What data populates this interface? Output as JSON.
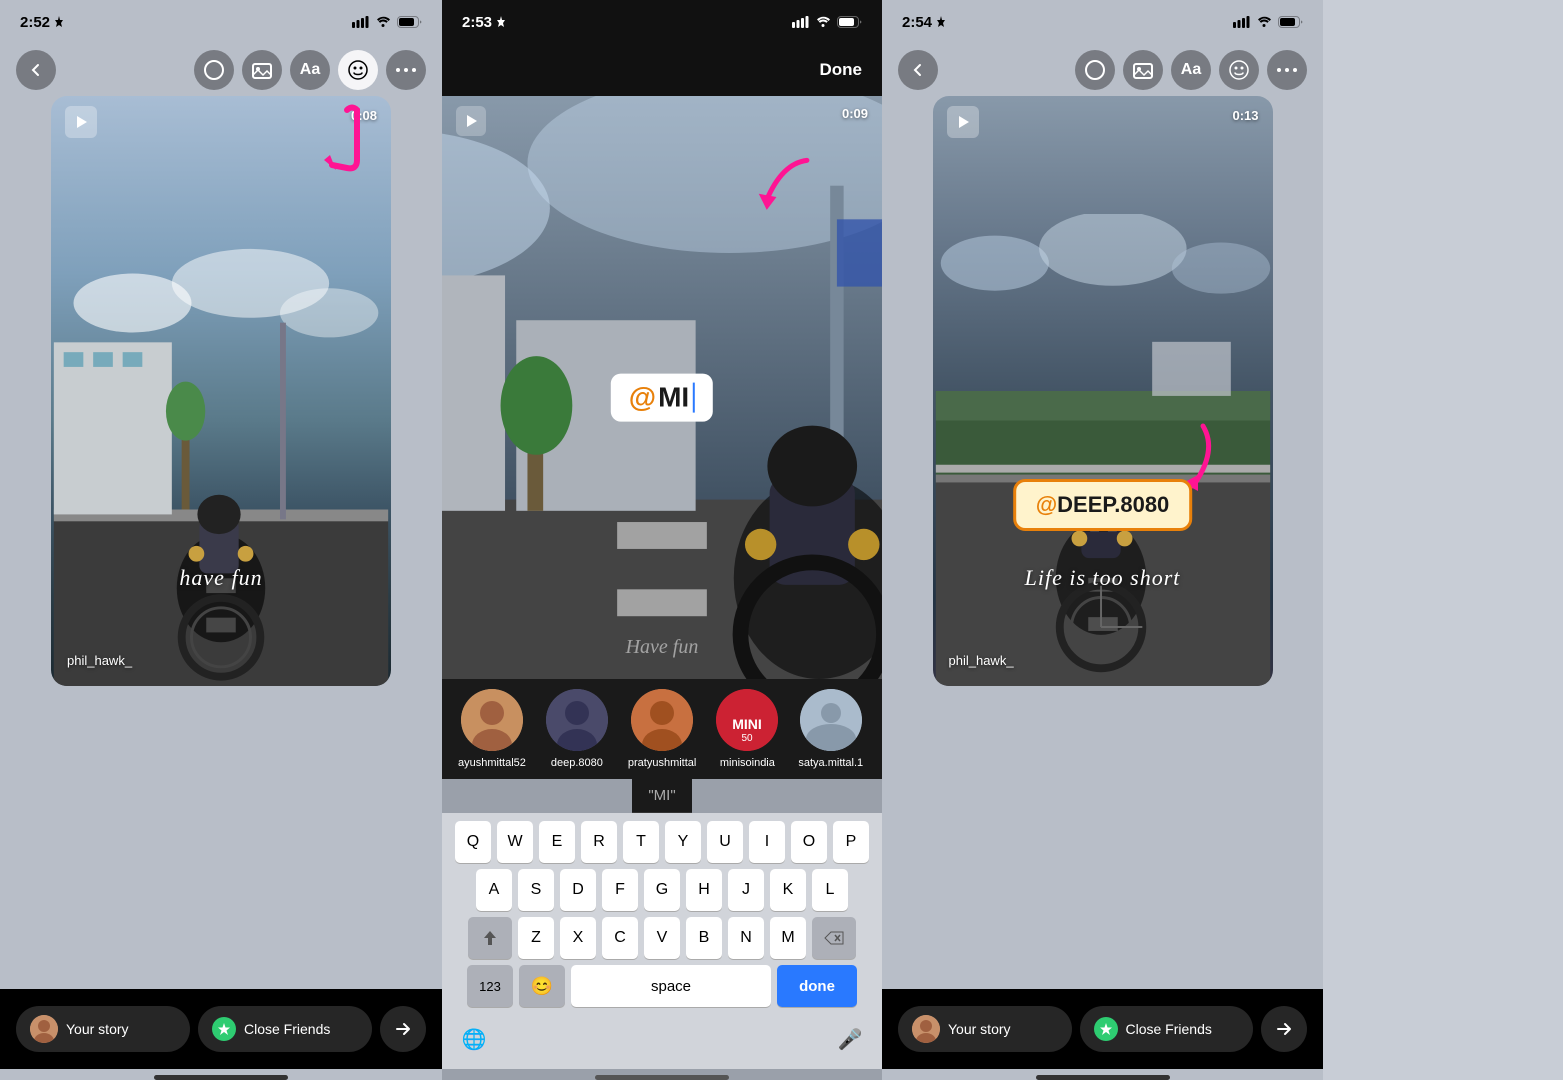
{
  "panels": {
    "left": {
      "statusBar": {
        "time": "2:52",
        "hasLocation": true
      },
      "toolbar": {
        "hasBack": true,
        "icons": [
          "circle",
          "gallery",
          "text",
          "sticker",
          "more"
        ],
        "activeIcon": "sticker"
      },
      "storyCard": {
        "duration": "0:08",
        "textOverlay": "have fun",
        "username": "phil_hawk_"
      },
      "bottomBar": {
        "storyLabel": "Your story",
        "closeFriendsLabel": "Close Friends"
      }
    },
    "mid": {
      "statusBar": {
        "time": "2:53",
        "hasLocation": true
      },
      "toolbar": {
        "doneLabel": "Done"
      },
      "storyCard": {
        "duration": "0:09",
        "textOverlay": "Have fun"
      },
      "mentionTag": "@MI",
      "suggestionHint": "\"MI\"",
      "suggestions": [
        {
          "name": "ayushmittal52"
        },
        {
          "name": "deep.8080"
        },
        {
          "name": "pratyushmittal"
        },
        {
          "name": "minisoindia",
          "verified": true
        },
        {
          "name": "satya.mittal.1"
        }
      ],
      "keyboard": {
        "row1": [
          "Q",
          "W",
          "E",
          "R",
          "T",
          "Y",
          "U",
          "I",
          "O",
          "P"
        ],
        "row2": [
          "A",
          "S",
          "D",
          "F",
          "G",
          "H",
          "J",
          "K",
          "L"
        ],
        "row3": [
          "Z",
          "X",
          "C",
          "V",
          "B",
          "N",
          "M"
        ],
        "bottomLeft": "123",
        "space": "space",
        "doneKey": "done"
      }
    },
    "right": {
      "statusBar": {
        "time": "2:54",
        "hasLocation": true
      },
      "toolbar": {
        "hasBack": true,
        "icons": [
          "circle",
          "gallery",
          "text",
          "sticker",
          "more"
        ]
      },
      "storyCard": {
        "duration": "0:13",
        "textOverlay": "Life is too short",
        "username": "phil_hawk_"
      },
      "mentionTagBottom": "@DEEP.8080",
      "bottomBar": {
        "storyLabel": "Your story",
        "closeFriendsLabel": "Close Friends"
      }
    }
  }
}
